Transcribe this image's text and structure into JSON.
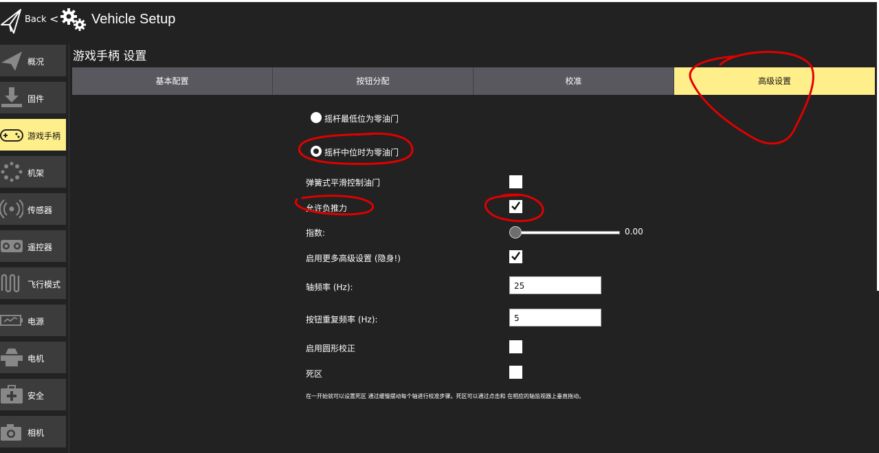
{
  "header": {
    "back_label": "Back",
    "back_chevron": "<",
    "title": "Vehicle Setup",
    "logo_icon": "paper-plane-icon",
    "settings_icon": "gears-icon"
  },
  "sidebar": {
    "items": [
      {
        "label": "概况",
        "icon": "paper-plane-icon"
      },
      {
        "label": "固件",
        "icon": "firmware-download-icon"
      },
      {
        "label": "游戏手柄",
        "icon": "gamepad-icon",
        "active": true
      },
      {
        "label": "机架",
        "icon": "airframe-icon"
      },
      {
        "label": "传感器",
        "icon": "sensors-icon"
      },
      {
        "label": "遥控器",
        "icon": "radio-controller-icon"
      },
      {
        "label": "飞行模式",
        "icon": "flight-modes-icon"
      },
      {
        "label": "电源",
        "icon": "battery-icon"
      },
      {
        "label": "电机",
        "icon": "motor-icon"
      },
      {
        "label": "安全",
        "icon": "first-aid-icon"
      },
      {
        "label": "相机",
        "icon": "camera-icon"
      }
    ]
  },
  "page": {
    "section_title": "游戏手柄 设置",
    "tabs": [
      {
        "label": "基本配置"
      },
      {
        "label": "按钮分配"
      },
      {
        "label": "校准"
      },
      {
        "label": "高级设置",
        "active": true
      }
    ]
  },
  "settings": {
    "throttle_low": {
      "label": "摇杆最低位为零油门",
      "selected": false
    },
    "throttle_center": {
      "label": "摇杆中位时为零油门",
      "selected": true
    },
    "spring_throttle": {
      "label": "弹簧式平滑控制油门",
      "checked": false
    },
    "negative_thrust": {
      "label": "允许负推力",
      "checked": true
    },
    "exponent": {
      "label": "指数:",
      "value": "0.00",
      "fraction": 0.0
    },
    "advanced_hidden": {
      "label": "启用更多高级设置 (隐身!)",
      "checked": true
    },
    "axis_rate": {
      "label": "轴频率 (Hz):",
      "value": "25"
    },
    "button_repeat": {
      "label": "按钮重复频率 (Hz):",
      "value": "5"
    },
    "circle_correction": {
      "label": "启用圆形校正",
      "checked": false
    },
    "deadband": {
      "label": "死区",
      "checked": false
    },
    "help_text": "在一开始就可以设置死区 通过缓慢摆动每个轴进行校准步骤。死区可以通过点击和 在相应的轴监视器上垂直拖动。"
  },
  "colors": {
    "background": "#222222",
    "sidebar_item": "#3c3c3c",
    "active": "#ffef8b",
    "tab": "#58585e",
    "annotation": "#e00000"
  }
}
